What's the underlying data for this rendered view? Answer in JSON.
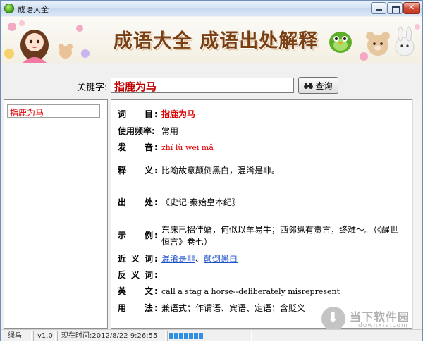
{
  "window": {
    "title": "成语大全"
  },
  "banner": {
    "title": "成语大全 成语出处解释"
  },
  "search": {
    "label": "关键字:",
    "value": "指鹿为马",
    "button_label": "查询"
  },
  "results": [
    {
      "label": "指鹿为马"
    }
  ],
  "detail": {
    "word": {
      "label_chars": [
        "词",
        "目"
      ],
      "colon": ":",
      "value": "指鹿为马"
    },
    "freq": {
      "label": "使用频率:",
      "value": "常用"
    },
    "pinyin": {
      "label_chars": [
        "发",
        "音"
      ],
      "colon": ":",
      "value": "zhǐ lù wéi mǎ"
    },
    "meaning": {
      "label_chars": [
        "释",
        "义"
      ],
      "colon": ":",
      "value": "比喻故意颠倒黑白，混淆是非。"
    },
    "source": {
      "label_chars": [
        "出",
        "处"
      ],
      "colon": ":",
      "value": "《史记·秦始皇本纪》"
    },
    "example": {
      "label_chars": [
        "示",
        "例"
      ],
      "colon": ":",
      "value": "东床已招佳婿，何似以羊易牛；西邻纵有责言，终难～。（《醒世恒言》卷七）"
    },
    "synonyms": {
      "label_chars": [
        "近",
        "义",
        "词"
      ],
      "colon": ":",
      "items": [
        "混淆是非",
        "颠倒黑白"
      ],
      "separator": "、"
    },
    "antonyms": {
      "label_chars": [
        "反",
        "义",
        "词"
      ],
      "colon": ":",
      "value": ""
    },
    "english": {
      "label_chars": [
        "英",
        "文"
      ],
      "colon": ":",
      "value": "call a stag a horse--deliberately misrepresent"
    },
    "usage": {
      "label_chars": [
        "用",
        "法"
      ],
      "colon": ":",
      "value": "兼语式；作谓语、宾语、定语；含贬义"
    }
  },
  "watermark": {
    "name": "当下软件园",
    "url": "downxia.com"
  },
  "status": {
    "user": "绿鸟",
    "version": "v1.0",
    "time": "现在时间:2012/8/22 9:26:55",
    "progress": 0.45
  },
  "colors": {
    "accent_red": "#e00000",
    "link_blue": "#1e50c8",
    "banner_title": "#7a3f12",
    "progress": "#2f8fe0"
  }
}
